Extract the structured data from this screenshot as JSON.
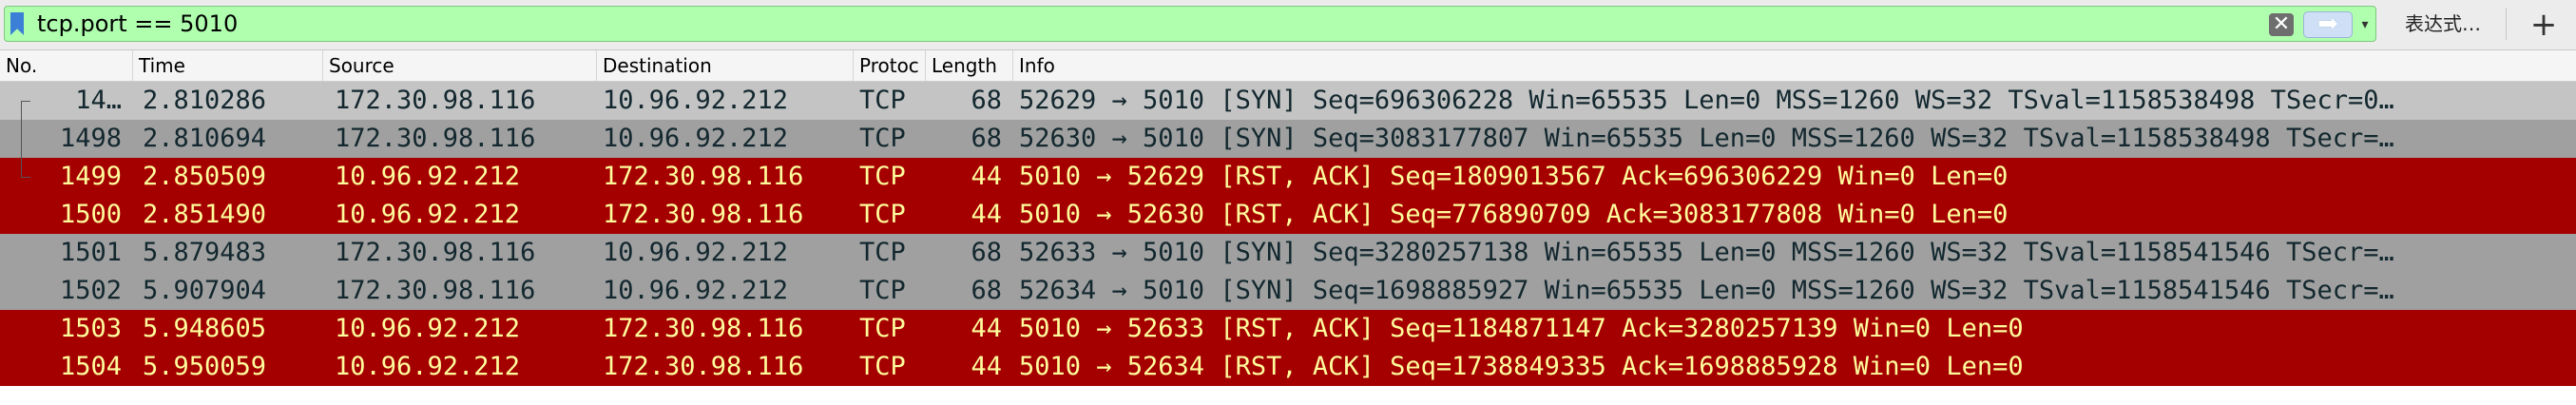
{
  "filter": {
    "value": "tcp.port == 5010",
    "clear_symbol": "✕",
    "apply_symbol": "➡",
    "recent_symbol": "▾",
    "expression_label": "表达式…",
    "add_symbol": "+"
  },
  "columns": [
    "No.",
    "Time",
    "Source",
    "Destination",
    "Protocol",
    "Length",
    "Info"
  ],
  "column_header_truncated": {
    "Protocol": "Protoc"
  },
  "colors": {
    "filter_valid": "#afffaf",
    "syn_row_bg": "#a0a0a0",
    "syn_row_fg": "#12272e",
    "rst_row_bg": "#a40000",
    "rst_row_fg": "#fffc9c",
    "selected_row_bg": "#c4c4c4"
  },
  "packets": [
    {
      "no": "14…",
      "time": "2.810286",
      "source": "172.30.98.116",
      "destination": "10.96.92.212",
      "protocol": "TCP",
      "length": "68",
      "info": "52629 → 5010 [SYN] Seq=696306228 Win=65535 Len=0 MSS=1260 WS=32 TSval=1158538498 TSecr=0…",
      "kind": "syn",
      "selected": true
    },
    {
      "no": "1498",
      "time": "2.810694",
      "source": "172.30.98.116",
      "destination": "10.96.92.212",
      "protocol": "TCP",
      "length": "68",
      "info": "52630 → 5010 [SYN] Seq=3083177807 Win=65535 Len=0 MSS=1260 WS=32 TSval=1158538498 TSecr=…",
      "kind": "syn",
      "selected": false
    },
    {
      "no": "1499",
      "time": "2.850509",
      "source": "10.96.92.212",
      "destination": "172.30.98.116",
      "protocol": "TCP",
      "length": "44",
      "info": "5010 → 52629 [RST, ACK] Seq=1809013567 Ack=696306229 Win=0 Len=0",
      "kind": "rst",
      "selected": false
    },
    {
      "no": "1500",
      "time": "2.851490",
      "source": "10.96.92.212",
      "destination": "172.30.98.116",
      "protocol": "TCP",
      "length": "44",
      "info": "5010 → 52630 [RST, ACK] Seq=776890709 Ack=3083177808 Win=0 Len=0",
      "kind": "rst",
      "selected": false
    },
    {
      "no": "1501",
      "time": "5.879483",
      "source": "172.30.98.116",
      "destination": "10.96.92.212",
      "protocol": "TCP",
      "length": "68",
      "info": "52633 → 5010 [SYN] Seq=3280257138 Win=65535 Len=0 MSS=1260 WS=32 TSval=1158541546 TSecr=…",
      "kind": "syn",
      "selected": false
    },
    {
      "no": "1502",
      "time": "5.907904",
      "source": "172.30.98.116",
      "destination": "10.96.92.212",
      "protocol": "TCP",
      "length": "68",
      "info": "52634 → 5010 [SYN] Seq=1698885927 Win=65535 Len=0 MSS=1260 WS=32 TSval=1158541546 TSecr=…",
      "kind": "syn",
      "selected": false
    },
    {
      "no": "1503",
      "time": "5.948605",
      "source": "10.96.92.212",
      "destination": "172.30.98.116",
      "protocol": "TCP",
      "length": "44",
      "info": "5010 → 52633 [RST, ACK] Seq=1184871147 Ack=3280257139 Win=0 Len=0",
      "kind": "rst",
      "selected": false
    },
    {
      "no": "1504",
      "time": "5.950059",
      "source": "10.96.92.212",
      "destination": "172.30.98.116",
      "protocol": "TCP",
      "length": "44",
      "info": "5010 → 52634 [RST, ACK] Seq=1738849335 Ack=1698885928 Win=0 Len=0",
      "kind": "rst",
      "selected": false
    }
  ]
}
